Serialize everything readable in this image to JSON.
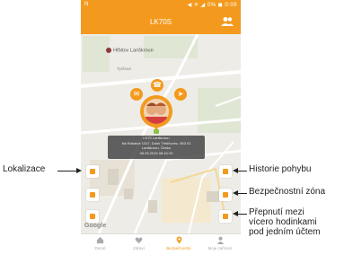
{
  "status_bar": {
    "left": "N",
    "right": "◀ ✳ ◢ 0% ◼ 0:09"
  },
  "app_bar": {
    "title": "LK70S"
  },
  "map": {
    "place": "Hřbitov Lanškroun",
    "street": "Tyršova",
    "google": "Google",
    "popup_lines": [
      "LK70 Lanškroun",
      "Na Rabatce 1317, Dolní Třešňovec, 563 01",
      "Lanškroun, Česko",
      "06.03.2019 08:16:19"
    ]
  },
  "bottom_nav": [
    {
      "label": "Domů",
      "icon": "home-icon"
    },
    {
      "label": "Zdraví",
      "icon": "heart-icon"
    },
    {
      "label": "Bezpečnostní",
      "icon": "location-pin-icon",
      "active": true
    },
    {
      "label": "Moje zařízení",
      "icon": "person-icon"
    }
  ],
  "callouts": {
    "lokalizace": "Lokalizace",
    "historie": "Historie pohybu",
    "zona": "Bezpečnostní zóna",
    "prepnuti_1": "Přepnutí mezi",
    "prepnuti_2": "vícero hodinkami",
    "prepnuti_3": "pod jedním účtem"
  },
  "colors": {
    "accent": "#f39a1e"
  }
}
